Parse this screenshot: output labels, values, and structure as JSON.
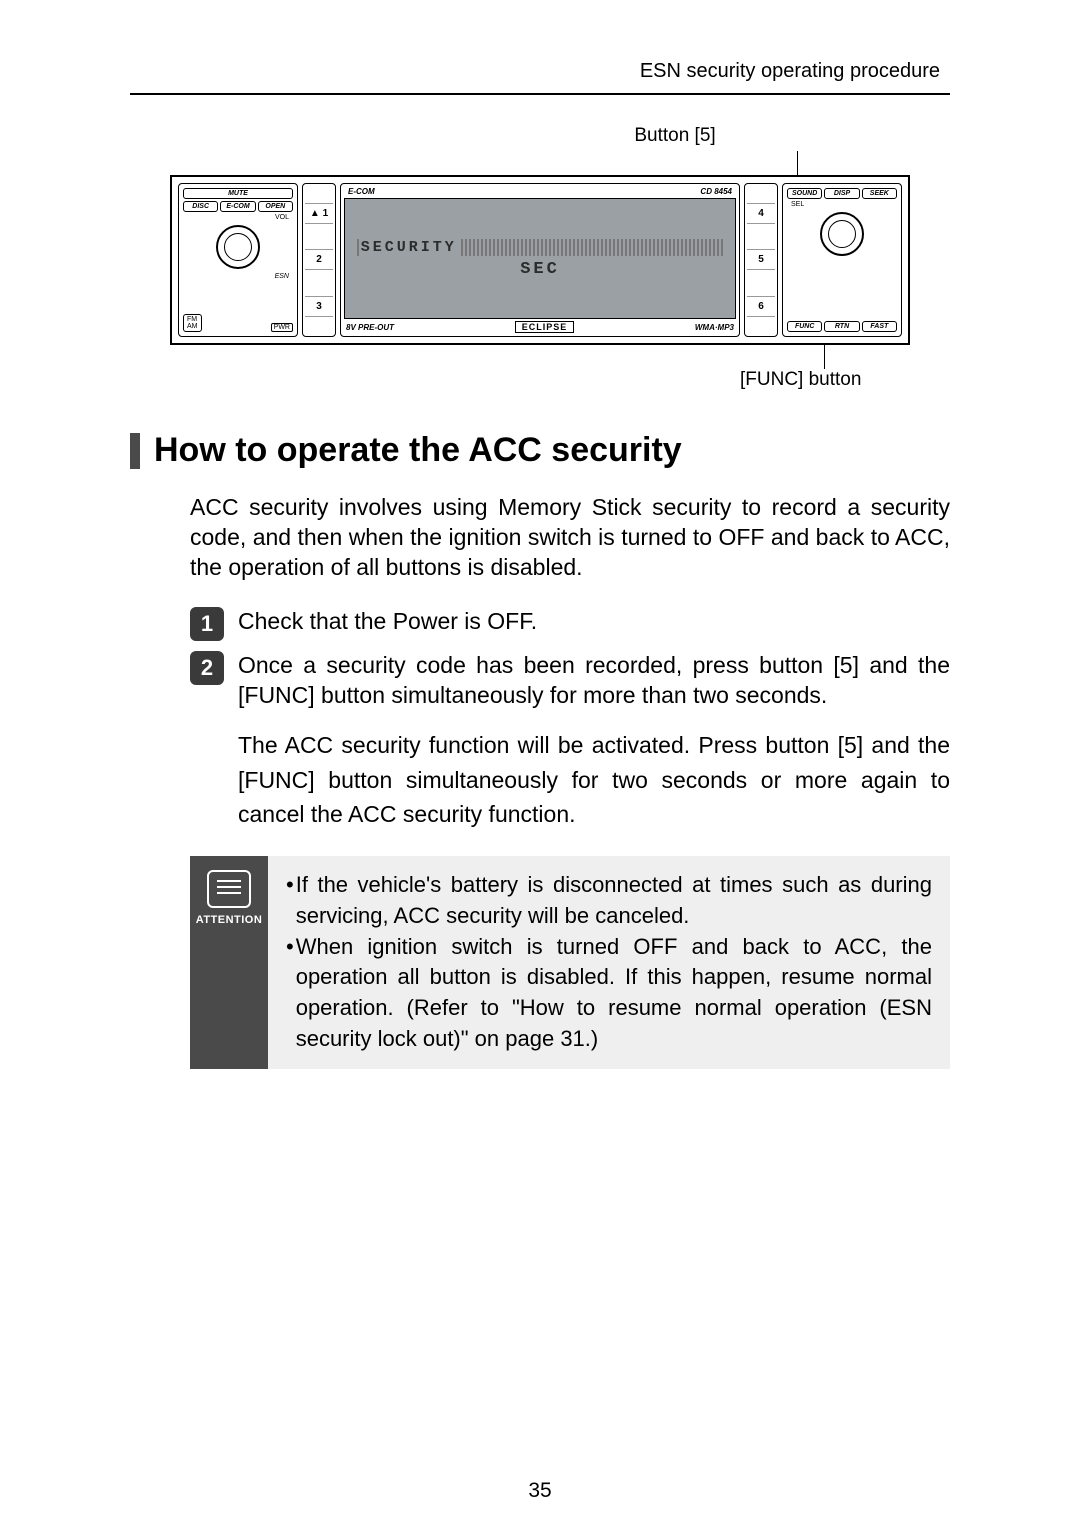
{
  "header": {
    "title": "ESN security operating procedure"
  },
  "diagram": {
    "callout_top": "Button [5]",
    "callout_bottom": "[FUNC] button",
    "left_buttons": {
      "mute": "MUTE",
      "disc": "DISC",
      "ecom": "E-COM",
      "open": "OPEN",
      "vol": "VOL",
      "esn": "ESN",
      "fm": "FM",
      "am": "AM",
      "pwr": "PWR"
    },
    "numcol_left": {
      "n1": "1",
      "n2": "2",
      "n3": "3",
      "eject": "▲"
    },
    "center": {
      "brand_left": "E-COM",
      "model_right": "CD 8454",
      "lcd_line1": "SECURITY",
      "lcd_line2": "SEC",
      "preout": "8V PRE-OUT",
      "wma": "WMA·MP3",
      "eclipse": "ECLIPSE"
    },
    "numcol_right": {
      "n4": "4",
      "n5": "5",
      "n6": "6"
    },
    "right_buttons": {
      "sound": "SOUND",
      "disp": "DISP",
      "seek": "SEEK",
      "sel": "SEL",
      "func": "FUNC",
      "rtn": "RTN",
      "fast": "FAST"
    }
  },
  "section": {
    "title": "How to operate the ACC security",
    "intro": "ACC security involves using Memory Stick security to record a security code, and then when the ignition switch is turned to OFF and back to ACC, the operation of all buttons is disabled."
  },
  "steps": {
    "s1_num": "1",
    "s1_text": "Check that the Power is OFF.",
    "s2_num": "2",
    "s2_text": "Once a security code has been recorded, press button [5] and the [FUNC] button simultaneously for more than two seconds.",
    "s2_detail": "The ACC security function will be activated. Press button [5] and the [FUNC] button simultaneously for two seconds or more again to cancel the ACC security function."
  },
  "attention": {
    "label": "ATTENTION",
    "b1": "If the vehicle's battery is disconnected at times such as during servicing, ACC security will be canceled.",
    "b2": "When ignition switch is turned OFF and back to ACC, the operation all button is disabled. If this happen, resume normal operation. (Refer to \"How to resume normal operation (ESN security lock out)\" on page 31.)"
  },
  "page_number": "35"
}
